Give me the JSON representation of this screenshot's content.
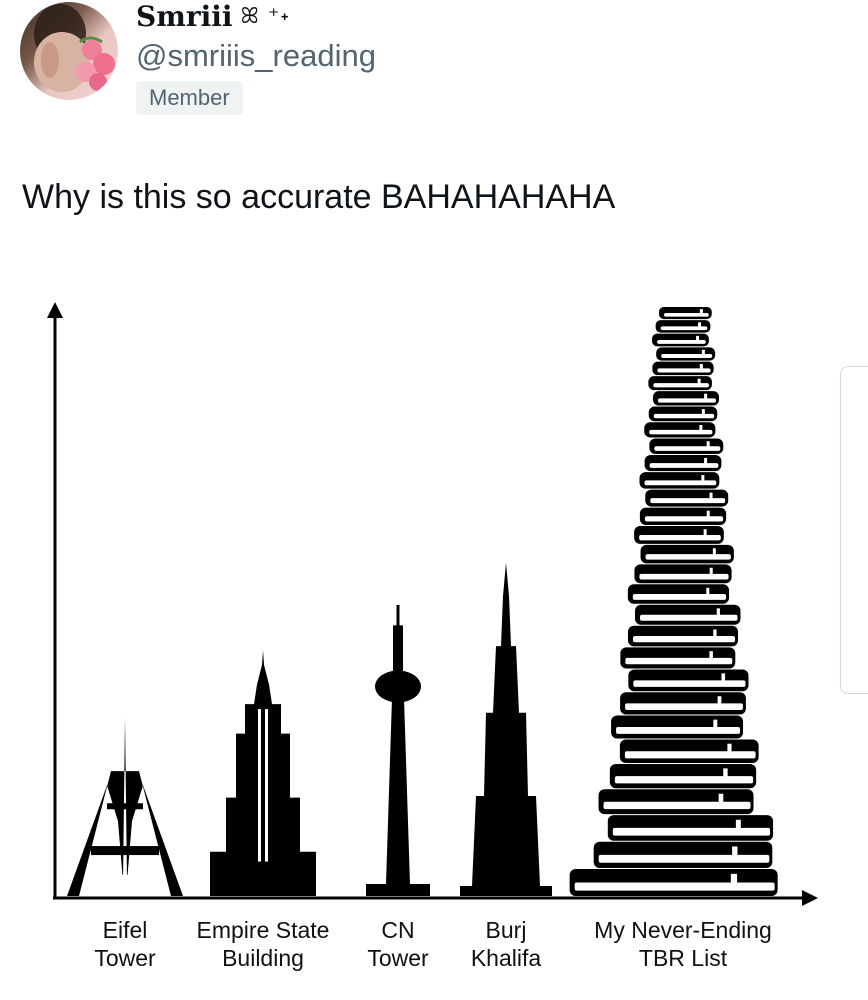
{
  "tweet": {
    "display_name": "Smriii",
    "name_decoration": "ꕤ ⁺˖",
    "handle": "@smriiis_reading",
    "badge": "Member",
    "text": "Why is this so accurate BAHAHAHAHA"
  },
  "chart_data": {
    "type": "bar",
    "categories": [
      [
        "Eifel",
        "Tower"
      ],
      [
        "Empire State",
        "Building"
      ],
      [
        "CN",
        "Tower"
      ],
      [
        "Burj",
        "Khalifa"
      ],
      [
        "My Never-Ending",
        "TBR List"
      ]
    ],
    "values": [
      190,
      262,
      310,
      355,
      620
    ],
    "title": "",
    "xlabel": "",
    "ylabel": "",
    "grid": false,
    "legend": "none"
  },
  "colors": {
    "ink": "#000000",
    "text": "#0f1419",
    "muted": "#536471",
    "badge_bg": "#eff3f4"
  },
  "icons": {
    "axis_arrows": "arrow-icon"
  }
}
